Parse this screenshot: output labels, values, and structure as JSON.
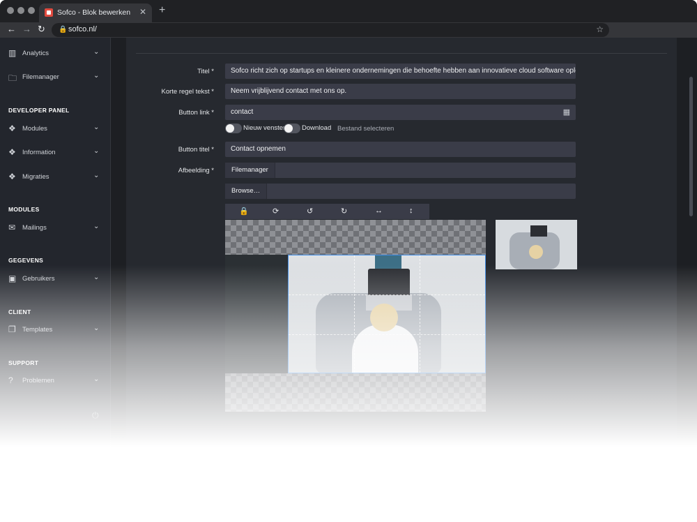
{
  "browser": {
    "tab_title": "Sofco - Blok bewerken",
    "url": "sofco.nl/",
    "close_glyph": "✕",
    "newtab_glyph": "+"
  },
  "sidebar": {
    "items_top": [
      {
        "label": "Analytics",
        "icon": "chart-icon"
      },
      {
        "label": "Filemanager",
        "icon": "folder-icon"
      }
    ],
    "sections": [
      {
        "title": "DEVELOPER PANEL",
        "items": [
          {
            "label": "Modules",
            "icon": "cubes-icon"
          },
          {
            "label": "Information",
            "icon": "cubes-icon"
          },
          {
            "label": "Migraties",
            "icon": "cubes-icon"
          }
        ]
      },
      {
        "title": "MODULES",
        "items": [
          {
            "label": "Mailings",
            "icon": "mail-icon"
          }
        ]
      },
      {
        "title": "GEGEVENS",
        "items": [
          {
            "label": "Gebruikers",
            "icon": "user-icon"
          }
        ]
      },
      {
        "title": "CLIENT",
        "items": [
          {
            "label": "Templates",
            "icon": "copy-icon"
          }
        ]
      },
      {
        "title": "SUPPORT",
        "items": [
          {
            "label": "Problemen",
            "icon": "question-icon"
          }
        ]
      }
    ]
  },
  "form": {
    "titel_label": "Titel *",
    "titel_value": "Sofco richt zich op startups en kleinere ondernemingen die behoefte hebben aan innovatieve cloud software oploss",
    "korte_label": "Korte regel tekst *",
    "korte_value": "Neem vrijblijvend contact met ons op.",
    "link_label": "Button link *",
    "link_value": "contact",
    "toggle_new_window": "Nieuw venster",
    "toggle_download": "Download",
    "select_file": "Bestand selecteren",
    "button_titel_label": "Button titel *",
    "button_titel_value": "Contact opnemen",
    "afbeelding_label": "Afbeelding *",
    "filemanager_button": "Filemanager",
    "browse_button": "Browse…"
  },
  "cropper_toolbar": [
    "lock-icon",
    "reset-icon",
    "rotate-left-icon",
    "rotate-right-icon",
    "flip-horizontal-icon",
    "flip-vertical-icon"
  ],
  "colors": {
    "sidebar_bg": "#23262d",
    "panel_bg": "#26292f",
    "field_bg": "#3a3c48",
    "crop_border": "#3f8ce6"
  }
}
